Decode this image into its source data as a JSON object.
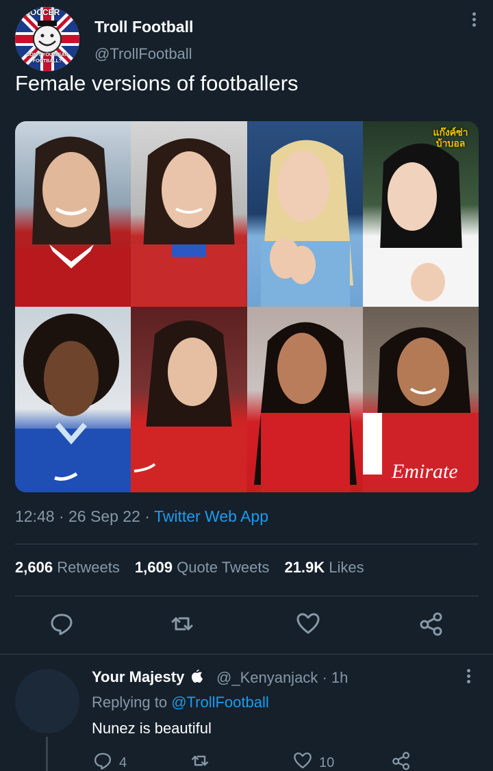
{
  "tweet": {
    "avatar_text_top": "SOCCER",
    "avatar_text_bottom": "DON'T YOU MEAN FOOTBALL?",
    "display_name": "Troll Football",
    "handle": "@TrollFootball",
    "text": "Female versions of footballers",
    "media_watermark": "แก๊งค์ซ่า บ้าบอล",
    "time": "12:48",
    "date": "26 Sep 22",
    "source": "Twitter Web App",
    "sep": "·"
  },
  "stats": {
    "retweets_count": "2,606",
    "retweets_label": "Retweets",
    "quotes_count": "1,609",
    "quotes_label": "Quote Tweets",
    "likes_count": "21.9K",
    "likes_label": "Likes"
  },
  "icons": {
    "reply": "reply-icon",
    "retweet": "retweet-icon",
    "like": "heart-icon",
    "share": "share-icon",
    "more": "more-vertical-icon",
    "verified_apple": "apple-icon"
  },
  "reply": {
    "display_name": "Your Majesty",
    "handle": "@_Kenyanjack",
    "age": "1h",
    "replying_label": "Replying to",
    "replying_to": "@TrollFootball",
    "text": "Nunez is beautiful",
    "reply_count": "4",
    "like_count": "10"
  },
  "colors": {
    "background": "#15202b",
    "text_secondary": "#8899a6",
    "link": "#1d9bf0",
    "divider": "#38444d"
  }
}
